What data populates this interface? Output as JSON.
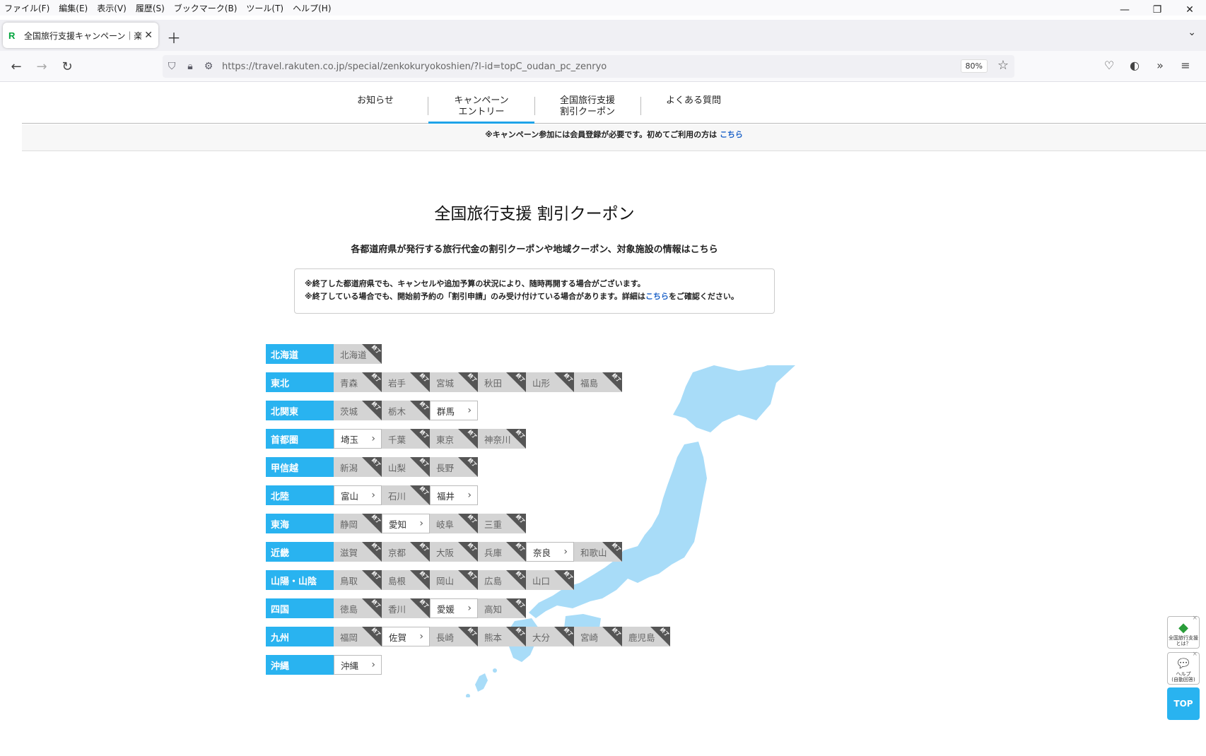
{
  "menubar": [
    "ファイル(F)",
    "編集(E)",
    "表示(V)",
    "履歴(S)",
    "ブックマーク(B)",
    "ツール(T)",
    "ヘルプ(H)"
  ],
  "tab": {
    "title": "全国旅行支援キャンペーン｜楽天"
  },
  "address": {
    "url": "https://travel.rakuten.co.jp/special/zenkokuryokoshien/?l-id=topC_oudan_pc_zenryo",
    "zoom": "80%"
  },
  "gnav": {
    "oshirase": "お知らせ",
    "entry_1": "キャンペーン",
    "entry_2": "エントリー",
    "coupon_1": "全国旅行支援",
    "coupon_2": "割引クーポン",
    "faq": "よくある質問"
  },
  "strip": {
    "text": "※キャンペーン参加には会員登録が必要です。初めてご利用の方は ",
    "link": "こちら"
  },
  "heading": "全国旅行支援 割引クーポン",
  "subheading": "各都道府県が発行する旅行代金の割引クーポンや地域クーポン、対象施設の情報はこちら",
  "info": {
    "line1": "※終了した都道府県でも、キャンセルや追加予算の状況により、随時再開する場合がございます。",
    "line2a": "※終了している場合でも、開始前予約の「割引申請」のみ受け付けている場合があります。詳細は",
    "line2link": "こちら",
    "line2b": "をご確認ください。"
  },
  "ended_label": "終了",
  "regions": [
    {
      "name": "北海道",
      "prefs": [
        {
          "n": "北海道",
          "s": "ended"
        }
      ]
    },
    {
      "name": "東北",
      "prefs": [
        {
          "n": "青森",
          "s": "ended"
        },
        {
          "n": "岩手",
          "s": "ended"
        },
        {
          "n": "宮城",
          "s": "ended"
        },
        {
          "n": "秋田",
          "s": "ended"
        },
        {
          "n": "山形",
          "s": "ended"
        },
        {
          "n": "福島",
          "s": "ended"
        }
      ]
    },
    {
      "name": "北関東",
      "prefs": [
        {
          "n": "茨城",
          "s": "ended"
        },
        {
          "n": "栃木",
          "s": "ended"
        },
        {
          "n": "群馬",
          "s": "open"
        }
      ]
    },
    {
      "name": "首都圏",
      "prefs": [
        {
          "n": "埼玉",
          "s": "open"
        },
        {
          "n": "千葉",
          "s": "ended"
        },
        {
          "n": "東京",
          "s": "ended"
        },
        {
          "n": "神奈川",
          "s": "ended"
        }
      ]
    },
    {
      "name": "甲信越",
      "prefs": [
        {
          "n": "新潟",
          "s": "ended"
        },
        {
          "n": "山梨",
          "s": "ended"
        },
        {
          "n": "長野",
          "s": "ended"
        }
      ]
    },
    {
      "name": "北陸",
      "prefs": [
        {
          "n": "富山",
          "s": "open"
        },
        {
          "n": "石川",
          "s": "ended"
        },
        {
          "n": "福井",
          "s": "open"
        }
      ]
    },
    {
      "name": "東海",
      "prefs": [
        {
          "n": "静岡",
          "s": "ended"
        },
        {
          "n": "愛知",
          "s": "open"
        },
        {
          "n": "岐阜",
          "s": "ended"
        },
        {
          "n": "三重",
          "s": "ended"
        }
      ]
    },
    {
      "name": "近畿",
      "prefs": [
        {
          "n": "滋賀",
          "s": "ended"
        },
        {
          "n": "京都",
          "s": "ended"
        },
        {
          "n": "大阪",
          "s": "ended"
        },
        {
          "n": "兵庫",
          "s": "ended"
        },
        {
          "n": "奈良",
          "s": "open"
        },
        {
          "n": "和歌山",
          "s": "ended"
        }
      ]
    },
    {
      "name": "山陽・山陰",
      "prefs": [
        {
          "n": "鳥取",
          "s": "ended"
        },
        {
          "n": "島根",
          "s": "ended"
        },
        {
          "n": "岡山",
          "s": "ended"
        },
        {
          "n": "広島",
          "s": "ended"
        },
        {
          "n": "山口",
          "s": "ended"
        }
      ]
    },
    {
      "name": "四国",
      "prefs": [
        {
          "n": "徳島",
          "s": "ended"
        },
        {
          "n": "香川",
          "s": "ended"
        },
        {
          "n": "愛媛",
          "s": "open"
        },
        {
          "n": "高知",
          "s": "ended"
        }
      ]
    },
    {
      "name": "九州",
      "prefs": [
        {
          "n": "福岡",
          "s": "ended"
        },
        {
          "n": "佐賀",
          "s": "open"
        },
        {
          "n": "長崎",
          "s": "ended"
        },
        {
          "n": "熊本",
          "s": "ended"
        },
        {
          "n": "大分",
          "s": "ended"
        },
        {
          "n": "宮崎",
          "s": "ended"
        },
        {
          "n": "鹿児島",
          "s": "ended"
        }
      ]
    },
    {
      "name": "沖縄",
      "prefs": [
        {
          "n": "沖縄",
          "s": "open"
        }
      ]
    }
  ],
  "widgets": {
    "w1_1": "全国旅行支援",
    "w1_2": "とは？",
    "w2_1": "ヘルプ",
    "w2_2": "(自動回答)",
    "top": "TOP"
  },
  "colors": {
    "accent": "#29b3f0",
    "map": "#a8dcf8",
    "link": "#1e63c8"
  }
}
